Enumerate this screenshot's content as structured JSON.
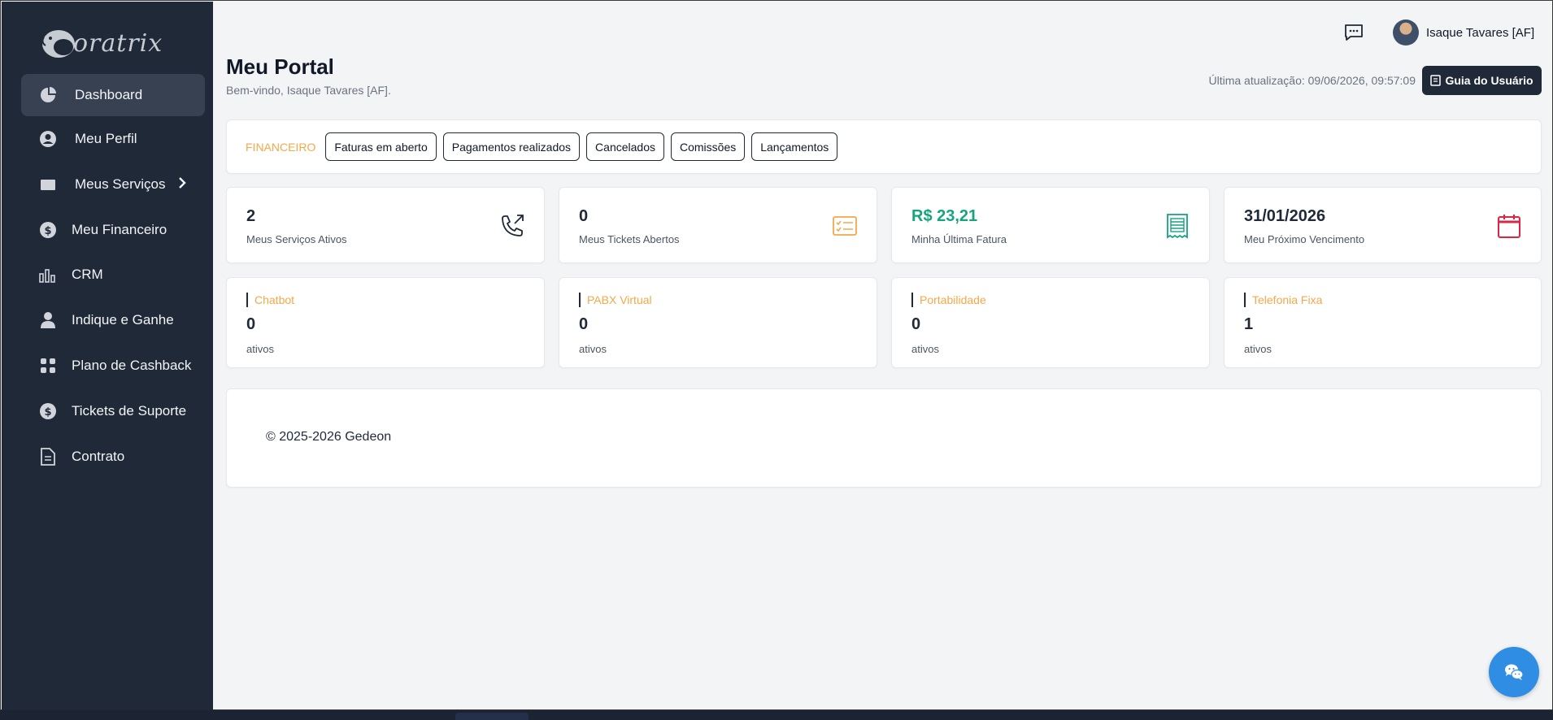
{
  "logo": {
    "text": "oratrix"
  },
  "sidebar": {
    "items": [
      {
        "label": "Dashboard",
        "icon": "pie-chart-icon",
        "active": true
      },
      {
        "label": "Meu Perfil",
        "icon": "user-circle-icon"
      },
      {
        "label": "Meus Serviços",
        "icon": "folder-icon",
        "has_submenu": true
      },
      {
        "label": "Meu Financeiro",
        "icon": "dollar-circle-icon"
      },
      {
        "label": "CRM",
        "icon": "bar-chart-icon"
      },
      {
        "label": "Indique e Ganhe",
        "icon": "user-icon"
      },
      {
        "label": "Plano de Cashback",
        "icon": "grid-icon"
      },
      {
        "label": "Tickets de Suporte",
        "icon": "dollar-circle-icon"
      },
      {
        "label": "Contrato",
        "icon": "document-icon"
      }
    ]
  },
  "header": {
    "user_name": "Isaque Tavares [AF]",
    "page_title": "Meu Portal",
    "welcome": "Bem-vindo, Isaque Tavares [AF].",
    "last_update": "Última atualização: 09/06/2026, 09:57:09",
    "guide_button": "Guia do Usuário"
  },
  "financeiro": {
    "label": "FINANCEIRO",
    "buttons": [
      "Faturas em aberto",
      "Pagamentos realizados",
      "Cancelados",
      "Comissões",
      "Lançamentos"
    ]
  },
  "stats": [
    {
      "value": "2",
      "label": "Meus Serviços Ativos",
      "icon": "phone-outgoing-icon",
      "color": "#1f2937"
    },
    {
      "value": "0",
      "label": "Meus Tickets Abertos",
      "icon": "checklist-icon",
      "color": "#f4a84a"
    },
    {
      "value": "R$ 23,21",
      "label": "Minha Última Fatura",
      "icon": "receipt-icon",
      "color": "#16a37f"
    },
    {
      "value": "31/01/2026",
      "label": "Meu Próximo Vencimento",
      "icon": "calendar-icon",
      "color": "#dc2644"
    }
  ],
  "services": [
    {
      "name": "Chatbot",
      "count": "0",
      "unit": "ativos"
    },
    {
      "name": "PABX Virtual",
      "count": "0",
      "unit": "ativos"
    },
    {
      "name": "Portabilidade",
      "count": "0",
      "unit": "ativos"
    },
    {
      "name": "Telefonia Fixa",
      "count": "1",
      "unit": "ativos"
    }
  ],
  "footer": {
    "copyright": "© 2025-2026 Gedeon"
  },
  "colors": {
    "sidebar": "#1f2937",
    "accent_orange": "#f4a84a",
    "fab_blue": "#2f8de4"
  }
}
